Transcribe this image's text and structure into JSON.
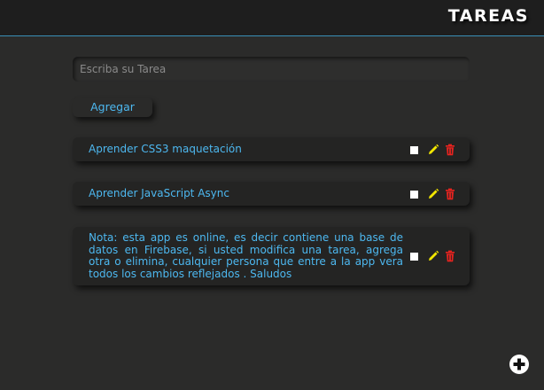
{
  "header": {
    "title": "TAREAS"
  },
  "form": {
    "input_placeholder": "Escriba su Tarea",
    "input_value": "",
    "add_label": "Agregar"
  },
  "tasks": [
    {
      "text": "Aprender CSS3 maquetación",
      "checked": false
    },
    {
      "text": "Aprender JavaScript Async",
      "checked": false
    },
    {
      "text": "Nota: esta app es online, es decir contiene una base de datos en Firebase, si usted modifica una tarea, agrega otra o elimina, cualquier persona que entre a la app vera todos los cambios reflejados . Saludos",
      "checked": false
    }
  ],
  "icons": {
    "edit": "pencil-icon",
    "delete": "trash-icon",
    "add": "plus-icon"
  },
  "colors": {
    "accent": "#4db8f0",
    "edit": "#f2e600",
    "delete": "#e8231f",
    "background": "#2b2b2a",
    "header": "#1e1e1e",
    "header_border": "#3a8fb7"
  }
}
